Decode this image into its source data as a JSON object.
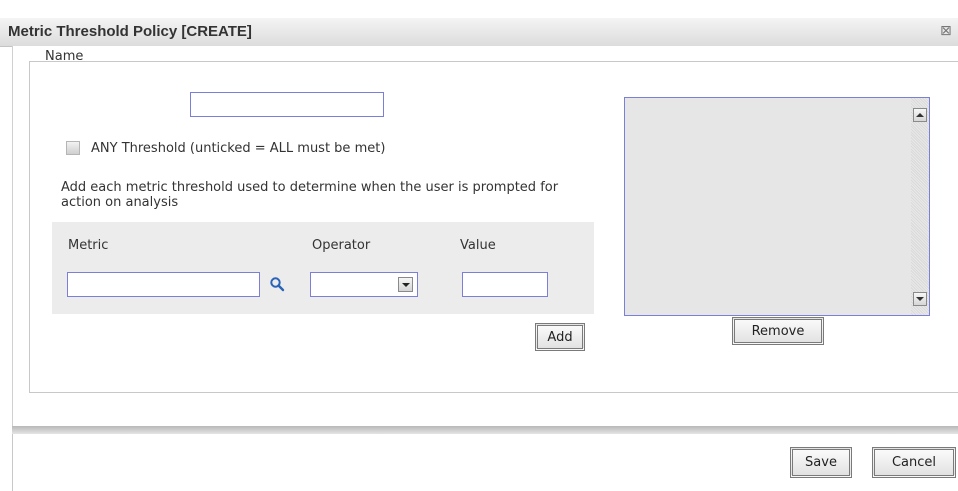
{
  "dialog": {
    "title": "Metric Threshold Policy [CREATE]",
    "close_icon": "close-icon"
  },
  "form": {
    "name_label": "Name",
    "name_value": "",
    "any_threshold_label": "ANY Threshold (unticked = ALL must be met)",
    "any_threshold_checked": false,
    "description": "Add each metric threshold used to determine when the user is prompted for action on analysis",
    "columns": {
      "metric": "Metric",
      "operator": "Operator",
      "value": "Value"
    },
    "metric_value": "",
    "operator_value": "",
    "value_value": "",
    "add_label": "Add"
  },
  "thresholds": {
    "items": [],
    "remove_label": "Remove"
  },
  "footer": {
    "save_label": "Save",
    "cancel_label": "Cancel"
  },
  "colors": {
    "input_border": "#7b7fd8",
    "panel_bg": "#ececec"
  },
  "icons": [
    "close-icon",
    "search-icon",
    "chevron-down-icon",
    "scroll-up-icon",
    "scroll-down-icon"
  ]
}
